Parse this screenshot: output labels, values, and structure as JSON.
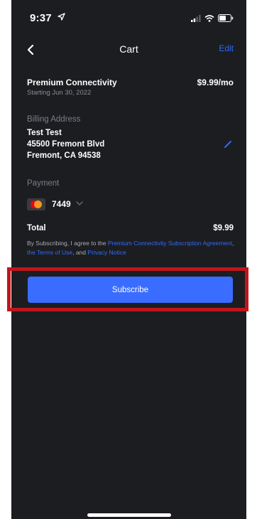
{
  "status_bar": {
    "time": "9:37"
  },
  "nav": {
    "title": "Cart",
    "edit_label": "Edit"
  },
  "plan": {
    "name": "Premium Connectivity",
    "start": "Starting Jun 30, 2022",
    "price": "$9.99/mo"
  },
  "billing": {
    "heading": "Billing Address",
    "name": "Test Test",
    "street": "45500 Fremont Blvd",
    "city": "Fremont, CA 94538"
  },
  "payment": {
    "heading": "Payment",
    "card_last4": "7449",
    "card_icon": "mastercard-icon"
  },
  "total": {
    "label": "Total",
    "value": "$9.99"
  },
  "agreement": {
    "prefix": "By Subscribing, I agree to the ",
    "link1": "Premium Connectivity Subscription Agreement",
    "sep": ", ",
    "link2": "the Terms of Use",
    "and": ", and ",
    "link3": "Privacy Notice"
  },
  "subscribe_label": "Subscribe",
  "colors": {
    "background": "#1c1d21",
    "accent": "#3a6cff",
    "link": "#2e6bff",
    "highlight": "#c0161b"
  }
}
